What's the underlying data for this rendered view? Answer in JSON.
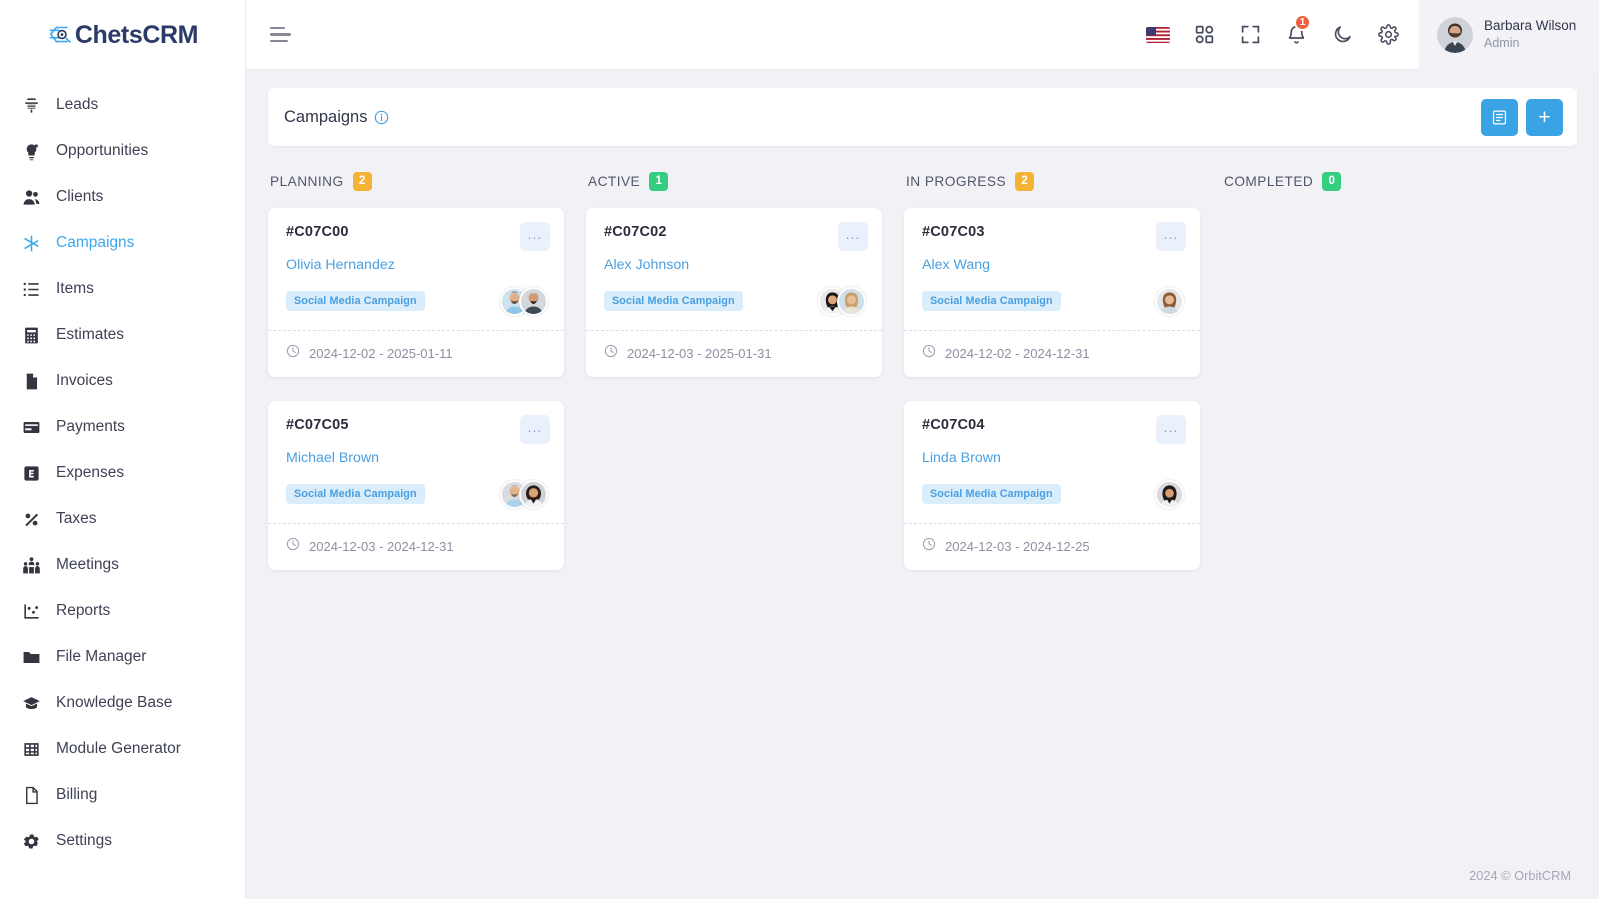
{
  "brand": {
    "name": "ChetsCRM",
    "logo_icon": "network-c-logo",
    "accent": "#3ba9ee"
  },
  "sidebar": {
    "items": [
      {
        "label": "Leads",
        "icon": "megaphone-icon",
        "active": false
      },
      {
        "label": "Opportunities",
        "icon": "lightbulb-icon",
        "active": false
      },
      {
        "label": "Clients",
        "icon": "users-icon",
        "active": false
      },
      {
        "label": "Campaigns",
        "icon": "asterisk-icon",
        "active": true
      },
      {
        "label": "Items",
        "icon": "list-icon",
        "active": false
      },
      {
        "label": "Estimates",
        "icon": "calculator-icon",
        "active": false
      },
      {
        "label": "Invoices",
        "icon": "file-icon",
        "active": false
      },
      {
        "label": "Payments",
        "icon": "credit-card-icon",
        "active": false
      },
      {
        "label": "Expenses",
        "icon": "expense-e-icon",
        "active": false
      },
      {
        "label": "Taxes",
        "icon": "percent-icon",
        "active": false
      },
      {
        "label": "Meetings",
        "icon": "people-group-icon",
        "active": false
      },
      {
        "label": "Reports",
        "icon": "chart-scatter-icon",
        "active": false
      },
      {
        "label": "File Manager",
        "icon": "folder-icon",
        "active": false
      },
      {
        "label": "Knowledge Base",
        "icon": "graduation-cap-icon",
        "active": false
      },
      {
        "label": "Module Generator",
        "icon": "grid-table-icon",
        "active": false
      },
      {
        "label": "Billing",
        "icon": "document-icon",
        "active": false
      },
      {
        "label": "Settings",
        "icon": "gear-icon",
        "active": false
      }
    ]
  },
  "topbar": {
    "menu_toggle_icon": "hamburger-icon",
    "icons": [
      {
        "name": "language-flag-us",
        "type": "flag"
      },
      {
        "name": "apps-grid-icon",
        "type": "svg"
      },
      {
        "name": "fullscreen-icon",
        "type": "svg"
      },
      {
        "name": "notifications-bell-icon",
        "type": "svg",
        "badge": "1"
      },
      {
        "name": "dark-mode-moon-icon",
        "type": "svg"
      },
      {
        "name": "settings-gear-icon",
        "type": "svg"
      }
    ],
    "notification_count": "1",
    "user": {
      "name": "Barbara Wilson",
      "role": "Admin",
      "avatar": "user-photo"
    }
  },
  "page": {
    "title": "Campaigns",
    "info_icon": "info-circle-icon",
    "actions": [
      {
        "name": "list-view-button",
        "icon": "list-view-icon",
        "label": ""
      },
      {
        "name": "add-campaign-button",
        "icon": "plus-icon",
        "label": "+"
      }
    ]
  },
  "board": {
    "columns": [
      {
        "title": "PLANNING",
        "count": "2",
        "badge_color": "#f5b335",
        "badge_style": "amber",
        "cards": [
          {
            "id": "#C07C00",
            "person": "Olivia Hernandez",
            "tag": "Social Media Campaign",
            "dates": "2024-12-02 - 2025-01-11",
            "avatars": 2,
            "menu": "..."
          },
          {
            "id": "#C07C05",
            "person": "Michael Brown",
            "tag": "Social Media Campaign",
            "dates": "2024-12-03 - 2024-12-31",
            "avatars": 2,
            "menu": "..."
          }
        ]
      },
      {
        "title": "ACTIVE",
        "count": "1",
        "badge_color": "#35cd7f",
        "badge_style": "green",
        "cards": [
          {
            "id": "#C07C02",
            "person": "Alex Johnson",
            "tag": "Social Media Campaign",
            "dates": "2024-12-03 - 2025-01-31",
            "avatars": 2,
            "menu": "..."
          }
        ]
      },
      {
        "title": "IN PROGRESS",
        "count": "2",
        "badge_color": "#f5b335",
        "badge_style": "amber",
        "cards": [
          {
            "id": "#C07C03",
            "person": "Alex Wang",
            "tag": "Social Media Campaign",
            "dates": "2024-12-02 - 2024-12-31",
            "avatars": 1,
            "menu": "..."
          },
          {
            "id": "#C07C04",
            "person": "Linda Brown",
            "tag": "Social Media Campaign",
            "dates": "2024-12-03 - 2024-12-25",
            "avatars": 1,
            "menu": "..."
          }
        ]
      },
      {
        "title": "COMPLETED",
        "count": "0",
        "badge_color": "#35cd7f",
        "badge_style": "green",
        "cards": []
      }
    ]
  },
  "footer": {
    "text": "2024 © OrbitCRM"
  }
}
